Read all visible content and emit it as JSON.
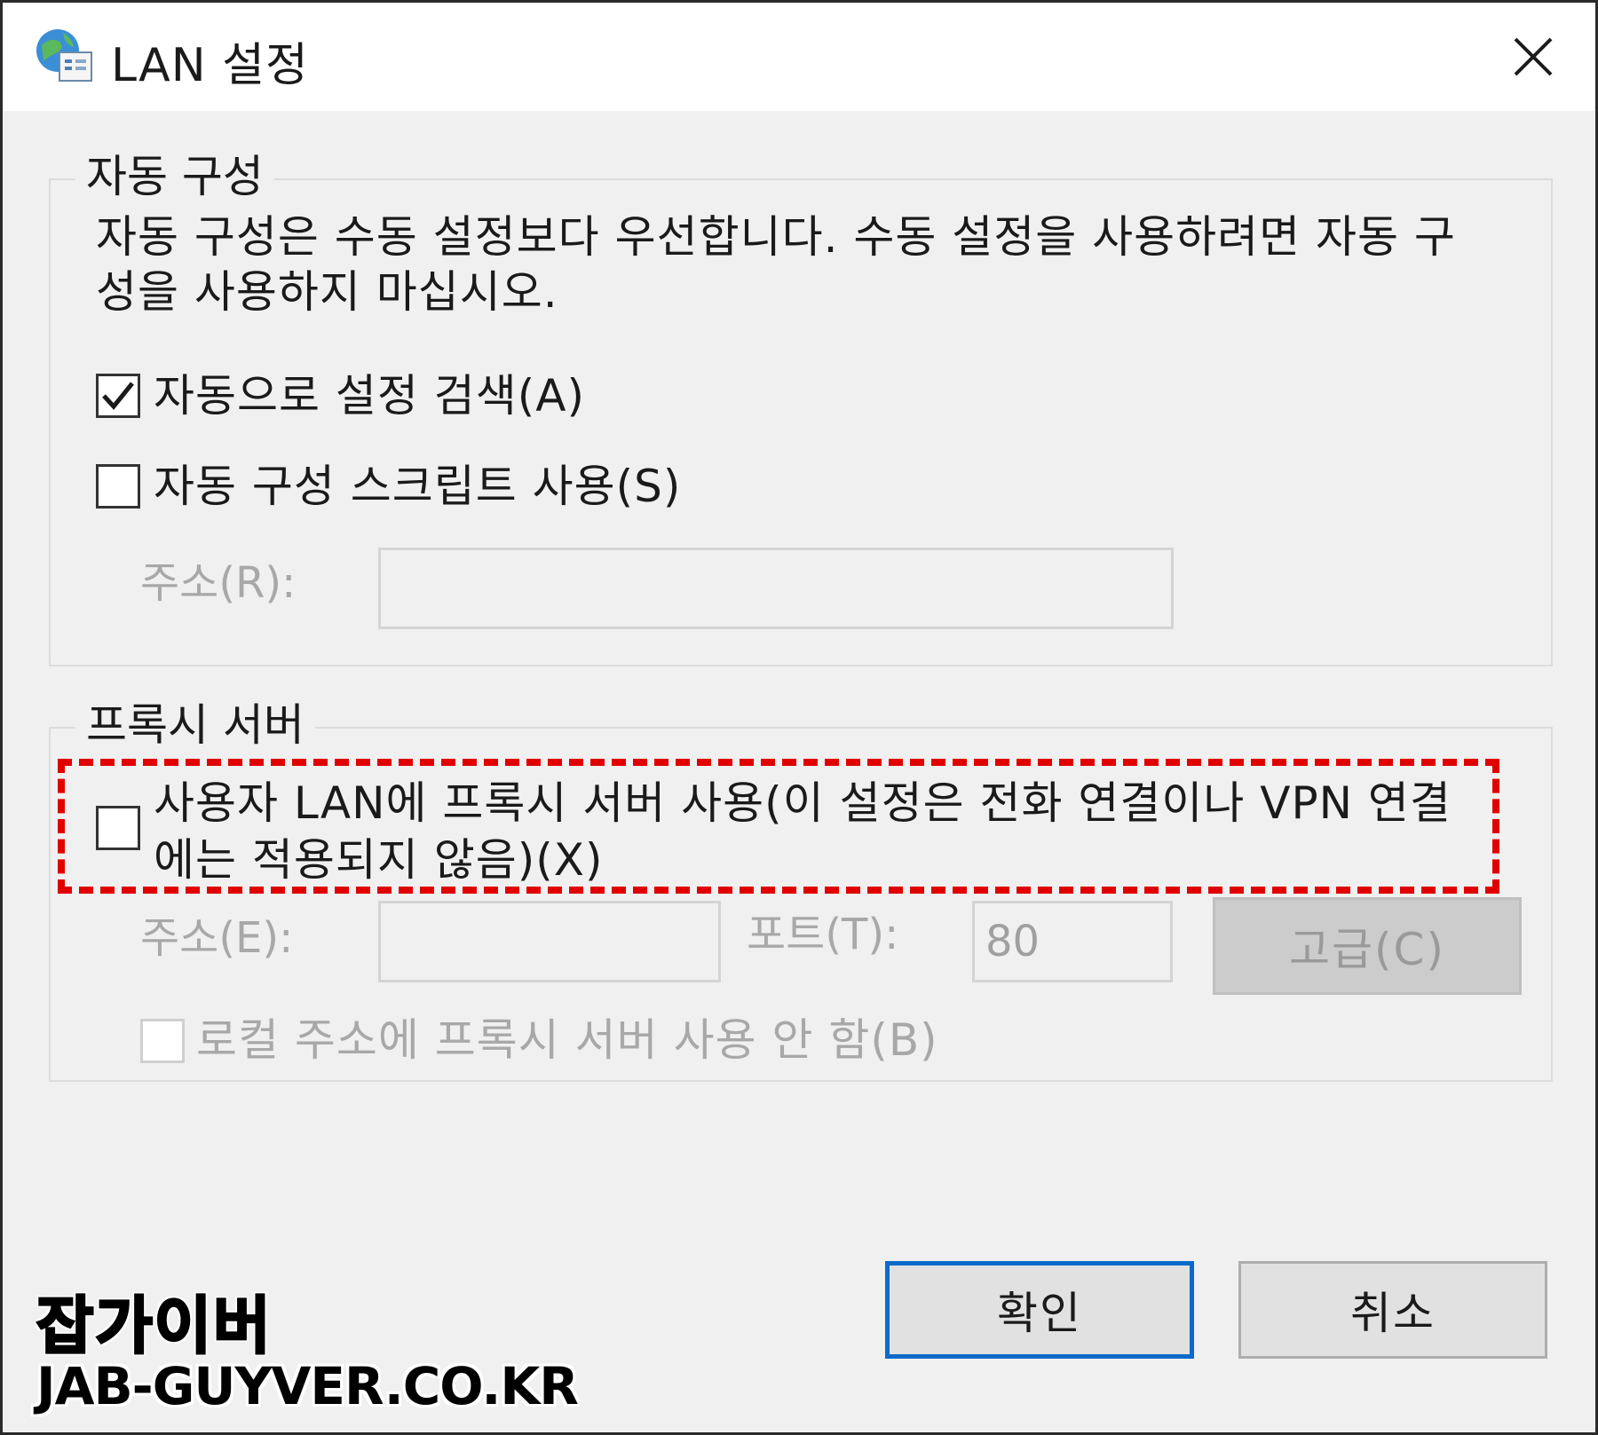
{
  "window": {
    "title": "LAN 설정",
    "icon": "internet-options-icon",
    "close_icon": "close-icon"
  },
  "auto_config": {
    "group_title": "자동 구성",
    "description_line1": "자동 구성은 수동 설정보다 우선합니다. 수동 설정을 사용하려면 자동 구",
    "description_line2": "성을 사용하지 마십시오.",
    "auto_detect": {
      "label": "자동으로 설정 검색(A)",
      "checked": true
    },
    "use_script": {
      "label": "자동 구성 스크립트 사용(S)",
      "checked": false
    },
    "address_label": "주소(R):",
    "address_value": ""
  },
  "proxy": {
    "group_title": "프록시 서버",
    "use_proxy": {
      "label_line1": "사용자 LAN에 프록시 서버 사용(이 설정은 전화 연결이나 VPN 연결",
      "label_line2": "에는 적용되지 않음)(X)",
      "checked": false
    },
    "address_label": "주소(E):",
    "address_value": "",
    "port_label": "포트(T):",
    "port_value": "80",
    "advanced_button": "고급(C)",
    "bypass_local": {
      "label": "로컬 주소에 프록시 서버 사용 안 함(B)",
      "checked": false
    }
  },
  "buttons": {
    "ok": "확인",
    "cancel": "취소"
  },
  "watermark": {
    "line1": "잡가이버",
    "line2": "JAB-GUYVER.CO.KR"
  },
  "colors": {
    "highlight": "#e00000",
    "default_button_border": "#0a6ac9"
  }
}
